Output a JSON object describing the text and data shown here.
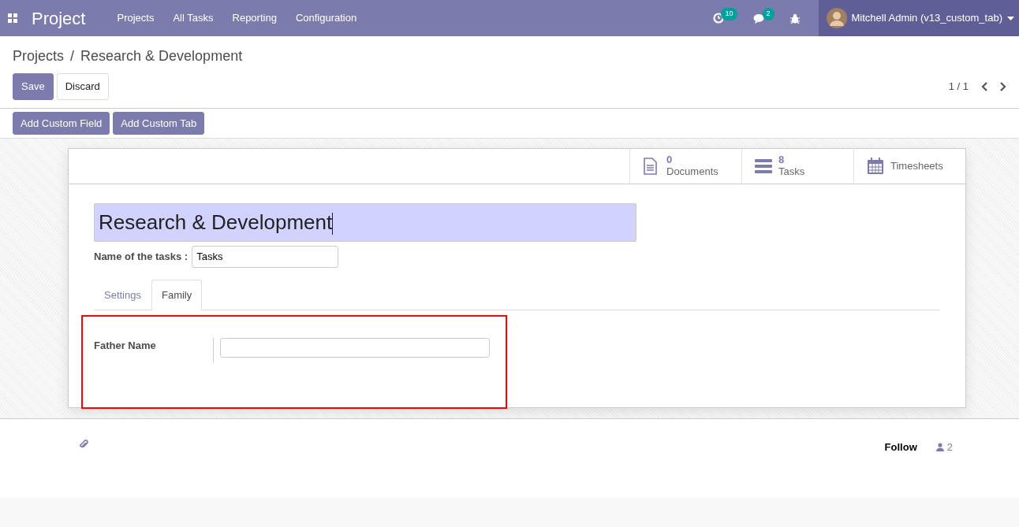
{
  "navbar": {
    "app_name": "Project",
    "menu": [
      "Projects",
      "All Tasks",
      "Reporting",
      "Configuration"
    ],
    "activity_count": "10",
    "message_count": "2",
    "user": "Mitchell Admin (v13_custom_tab)"
  },
  "breadcrumb": {
    "items": [
      "Projects",
      "Research & Development"
    ],
    "separator": "/"
  },
  "actions": [
    {
      "label": "Save",
      "kind": "primary"
    },
    {
      "label": "Discard",
      "kind": "secondary"
    }
  ],
  "pager": "1 / 1",
  "custom_buttons": [
    "Add Custom Field",
    "Add Custom Tab"
  ],
  "smart_buttons": [
    {
      "kind": "document",
      "count": "0",
      "label": "Documents"
    },
    {
      "kind": "tasks",
      "count": "8",
      "label": "Tasks"
    },
    {
      "kind": "calendar",
      "label": "Timesheets"
    }
  ],
  "title": "Research & Development",
  "task_name": {
    "label": "Name of the tasks :",
    "value": "Tasks"
  },
  "tabs": [
    {
      "label": "Settings",
      "selected": false
    },
    {
      "label": "Family",
      "selected": true
    }
  ],
  "fields": [
    {
      "label": "Father Name"
    }
  ],
  "chatter": {
    "follow": "Follow",
    "followers": "2"
  }
}
